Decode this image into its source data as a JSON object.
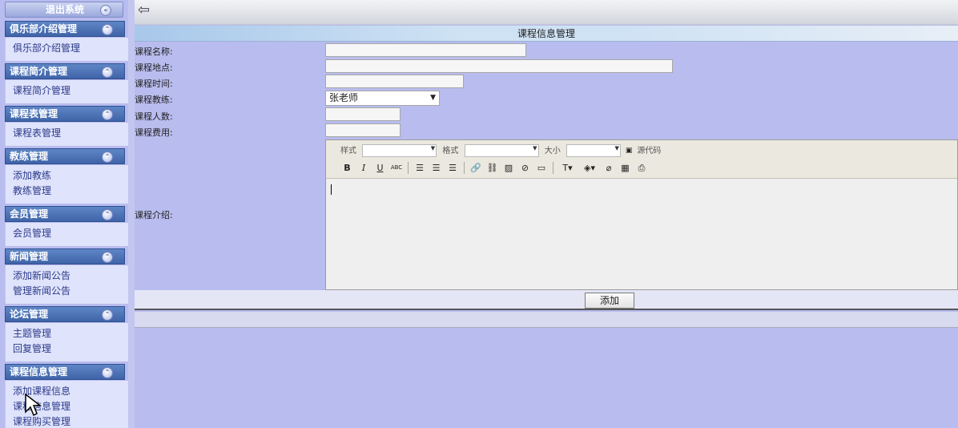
{
  "sidebar": {
    "logout_label": "退出系统",
    "sections": [
      {
        "title": "俱乐部介绍管理",
        "items": [
          "俱乐部介绍管理"
        ]
      },
      {
        "title": "课程简介管理",
        "items": [
          "课程简介管理"
        ]
      },
      {
        "title": "课程表管理",
        "items": [
          "课程表管理"
        ]
      },
      {
        "title": "教练管理",
        "items": [
          "添加教练",
          "教练管理"
        ]
      },
      {
        "title": "会员管理",
        "items": [
          "会员管理"
        ]
      },
      {
        "title": "新闻管理",
        "items": [
          "添加新闻公告",
          "管理新闻公告"
        ]
      },
      {
        "title": "论坛管理",
        "items": [
          "主题管理",
          "回复管理"
        ]
      },
      {
        "title": "课程信息管理",
        "items": [
          "添加课程信息",
          "课程信息管理",
          "课程购买管理"
        ]
      }
    ]
  },
  "page_title": "课程信息管理",
  "form": {
    "name_label": "课程名称:",
    "place_label": "课程地点:",
    "time_label": "课程时间:",
    "coach_label": "课程教练:",
    "coach_value": "张老师",
    "count_label": "课程人数:",
    "fee_label": "课程费用:",
    "intro_label": "课程介绍:",
    "editor": {
      "style_label": "样式",
      "format_label": "格式",
      "size_label": "大小",
      "source_label": "源代码"
    },
    "submit_label": "添加"
  }
}
